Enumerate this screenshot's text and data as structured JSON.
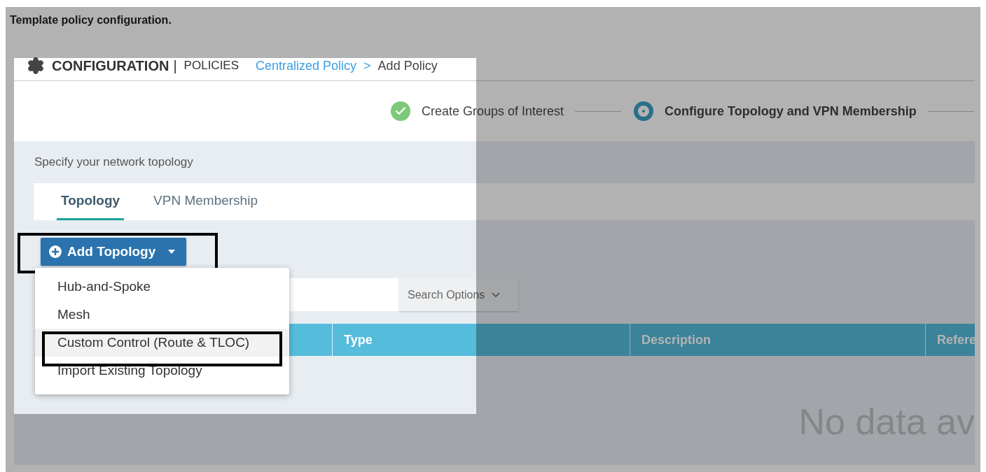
{
  "caption": "Template policy configuration.",
  "header": {
    "section": "CONFIGURATION",
    "separator": "|",
    "subsection": "POLICIES",
    "breadcrumb": [
      {
        "label": "Centralized Policy",
        "kind": "link"
      },
      {
        "label": ">",
        "kind": "separator"
      },
      {
        "label": "Add Policy",
        "kind": "current"
      }
    ]
  },
  "steps": [
    {
      "label": "Create Groups of Interest",
      "completed": true,
      "active": false
    },
    {
      "label": "Configure Topology and VPN Membership",
      "completed": false,
      "active": true
    }
  ],
  "instruction": "Specify your network topology",
  "tabs": [
    {
      "label": "Topology",
      "selected": true
    },
    {
      "label": "VPN Membership",
      "selected": false
    }
  ],
  "add_button": {
    "label": "Add Topology",
    "highlighted": true,
    "expanded": true
  },
  "menu": [
    {
      "label": "Hub-and-Spoke",
      "hovered": false,
      "highlighted": false
    },
    {
      "label": "Mesh",
      "hovered": false,
      "highlighted": false
    },
    {
      "label": "Custom Control (Route & TLOC)",
      "hovered": true,
      "highlighted": true
    },
    {
      "label": "Import Existing Topology",
      "hovered": false,
      "highlighted": false
    }
  ],
  "search": {
    "options_label": "Search Options"
  },
  "table": {
    "columns": [
      "Type",
      "Description",
      "Refere"
    ],
    "empty_message": "No data av"
  }
}
